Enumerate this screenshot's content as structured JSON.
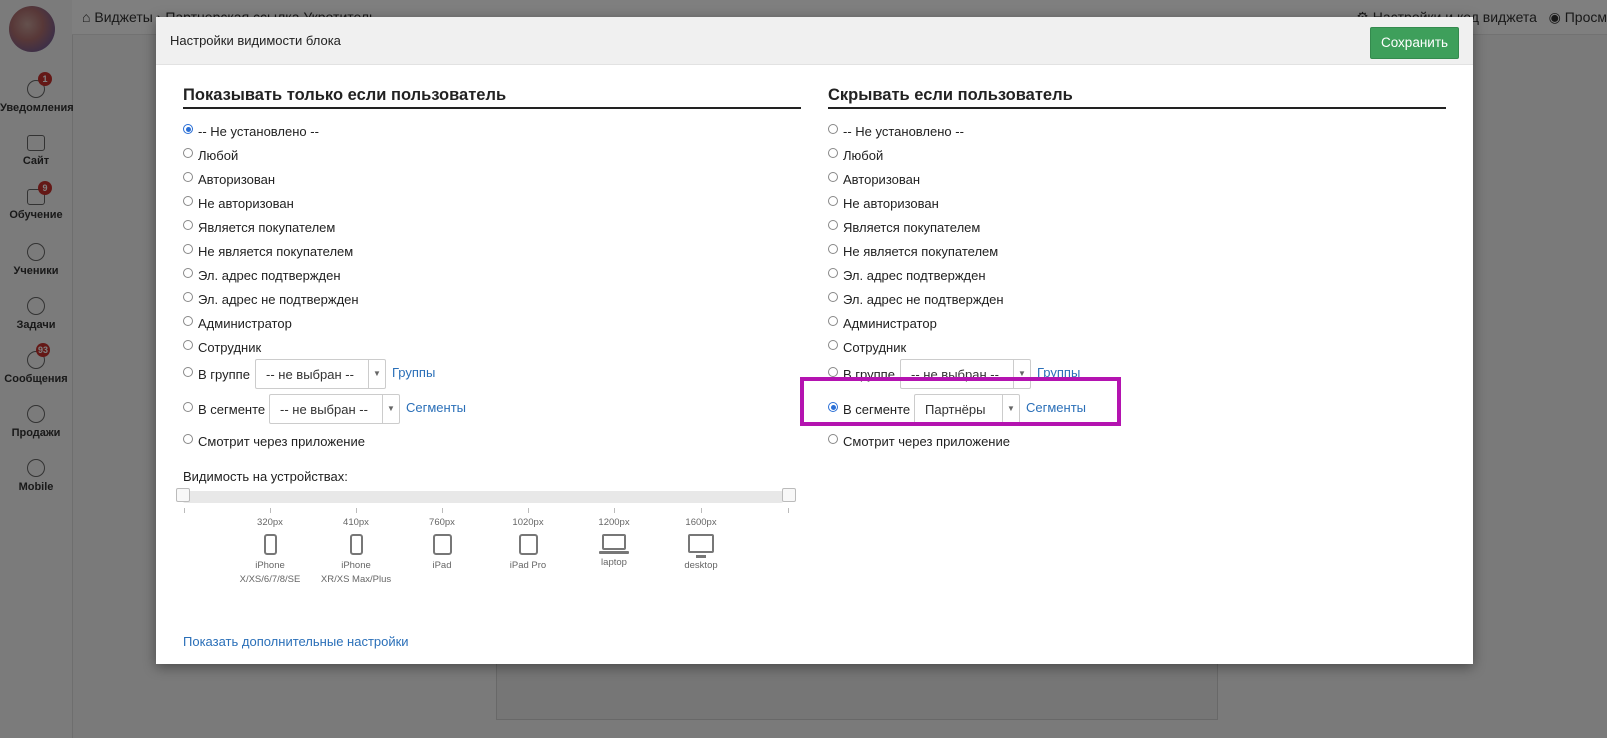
{
  "sidebar": {
    "items": [
      {
        "label": "Уведомления",
        "icon": "bell-icon",
        "badge": "1"
      },
      {
        "label": "Сайт",
        "icon": "monitor-icon",
        "badge": ""
      },
      {
        "label": "Обучение",
        "icon": "book-icon",
        "badge": "9"
      },
      {
        "label": "Ученики",
        "icon": "users-icon",
        "badge": ""
      },
      {
        "label": "Задачи",
        "icon": "target-icon",
        "badge": ""
      },
      {
        "label": "Сообщения",
        "icon": "chat-icon",
        "badge": "93"
      },
      {
        "label": "Продажи",
        "icon": "dollar-icon",
        "badge": ""
      },
      {
        "label": "Mobile",
        "icon": "mobile-icon",
        "badge": ""
      }
    ]
  },
  "topbar": {
    "home": "Виджеты",
    "separator": "›",
    "current": "Партнерская ссылка Укротитель",
    "settings_link": "Настройки и код виджета",
    "preview_link": "Просм"
  },
  "modal": {
    "title": "Настройки видимости блока",
    "save_label": "Сохранить",
    "show_title": "Показывать только если пользователь",
    "hide_title": "Скрывать если пользователь",
    "options": [
      "-- Не установлено --",
      "Любой",
      "Авторизован",
      "Не авторизован",
      "Является покупателем",
      "Не является покупателем",
      "Эл. адрес подтвержден",
      "Эл. адрес не подтвержден",
      "Администратор",
      "Сотрудник"
    ],
    "group_label": "В группе",
    "segment_label": "В сегменте",
    "app_label": "Смотрит через приложение",
    "groups_link": "Группы",
    "segments_link": "Сегменты",
    "left": {
      "selected": "-- Не установлено --",
      "group_select": "-- не выбран --",
      "segment_select": "-- не выбран --"
    },
    "right": {
      "selected": "В сегменте",
      "group_select": "-- не выбран --",
      "segment_select": "Партнёры"
    },
    "devices_label": "Видимость на устройствах:",
    "devices": [
      {
        "px": "320px",
        "name": "iPhone X/XS/6/7/8/SE",
        "name1": "iPhone",
        "name2": "X/XS/6/7/8/SE",
        "icon": "phone-icon"
      },
      {
        "px": "410px",
        "name": "iPhone XR/XS Max/Plus",
        "name1": "iPhone",
        "name2": "XR/XS Max/Plus",
        "icon": "phone-icon"
      },
      {
        "px": "760px",
        "name": "iPad",
        "name1": "iPad",
        "name2": "",
        "icon": "tablet-icon"
      },
      {
        "px": "1020px",
        "name": "iPad Pro",
        "name1": "iPad Pro",
        "name2": "",
        "icon": "tablet-icon"
      },
      {
        "px": "1200px",
        "name": "laptop",
        "name1": "laptop",
        "name2": "",
        "icon": "laptop-icon"
      },
      {
        "px": "1600px",
        "name": "desktop",
        "name1": "desktop",
        "name2": "",
        "icon": "desktop-icon"
      }
    ],
    "more_settings": "Показать дополнительные настройки"
  },
  "colors": {
    "accent": "#2a6fb8",
    "save": "#3e9f5b",
    "highlight": "#b413b0",
    "badge": "#c9302c"
  }
}
